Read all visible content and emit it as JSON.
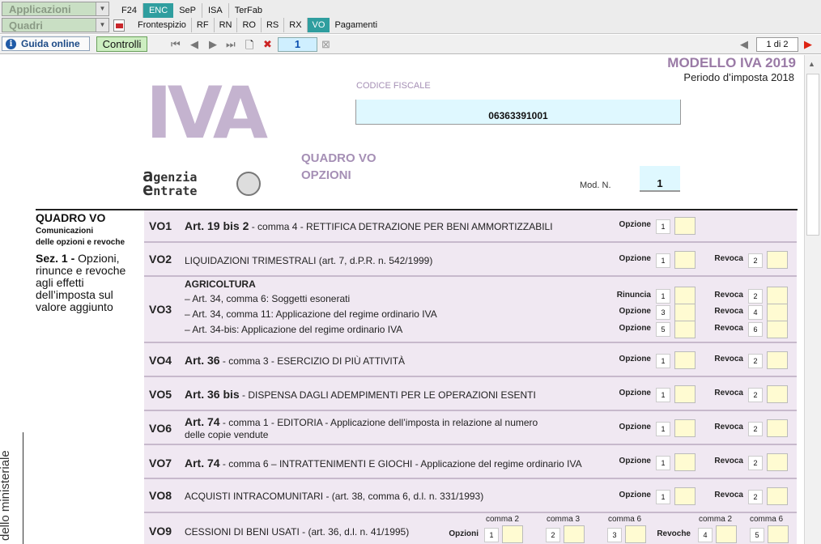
{
  "topbar": {
    "applicazioni": "Applicazioni",
    "quadri": "Quadri",
    "tabs1": [
      "F24",
      "ENC",
      "SeP",
      "ISA",
      "TerFab"
    ],
    "tabs2": [
      "Frontespizio",
      "RF",
      "RN",
      "RO",
      "RS",
      "RX",
      "VO",
      "Pagamenti"
    ]
  },
  "toolbar": {
    "guida": "Guida online",
    "controlli": "Controlli",
    "page": "1",
    "of": "1 di 2"
  },
  "header": {
    "title": "MODELLO IVA 2019",
    "period": "Periodo d’imposta 2018",
    "cf_label": "CODICE FISCALE",
    "cf_value": "06363391001",
    "quadro": "QUADRO VO",
    "opzioni": "OPZIONI",
    "mod_label": "Mod. N.",
    "mod_value": "1",
    "logo": "IVA",
    "agenzia1": "genzia",
    "agenzia2": "ntrate"
  },
  "left": {
    "q": "QUADRO VO",
    "c1": "Comunicazioni",
    "c2": "delle opzioni e revoche",
    "sez": "Sez. 1 -",
    "sez_text": "Opzioni, rinunce e revoche agli effetti dell’imposta sul valore aggiunto",
    "vertical": "dello ministeriale"
  },
  "rows": {
    "vo1": {
      "code": "VO1",
      "art": "Art. 19 bis 2",
      "text": "- comma 4 - RETTIFICA DETRAZIONE PER BENI AMMORTIZZABILI",
      "l1": "Opzione",
      "n1": "1"
    },
    "vo2": {
      "code": "VO2",
      "text": "LIQUIDAZIONI TRIMESTRALI  (art. 7, d.P.R. n. 542/1999)",
      "l1": "Opzione",
      "n1": "1",
      "l2": "Revoca",
      "n2": "2"
    },
    "vo3": {
      "code": "VO3",
      "head": "AGRICOLTURA",
      "t1": "– Art. 34, comma   6: Soggetti esonerati",
      "t2": "– Art. 34, comma 11: Applicazione del regime ordinario IVA",
      "t3": "– Art. 34-bis: Applicazione del regime ordinario IVA",
      "a": "Rinuncia",
      "b": "Opzione",
      "c": "Opzione",
      "r": "Revoca",
      "n1": "1",
      "n2": "2",
      "n3": "3",
      "n4": "4",
      "n5": "5",
      "n6": "6"
    },
    "vo4": {
      "code": "VO4",
      "art": "Art. 36",
      "text": "- comma 3 - ESERCIZIO DI PIÙ ATTIVITÀ",
      "l1": "Opzione",
      "n1": "1",
      "l2": "Revoca",
      "n2": "2"
    },
    "vo5": {
      "code": "VO5",
      "art": "Art. 36 bis",
      "text": "- DISPENSA DAGLI ADEMPIMENTI PER LE OPERAZIONI ESENTI",
      "l1": "Opzione",
      "n1": "1",
      "l2": "Revoca",
      "n2": "2"
    },
    "vo6": {
      "code": "VO6",
      "art": "Art. 74",
      "text": "- comma 1 - EDITORIA - Applicazione dell’imposta in relazione al numero",
      "text2": "delle copie vendute",
      "l1": "Opzione",
      "n1": "1",
      "l2": "Revoca",
      "n2": "2"
    },
    "vo7": {
      "code": "VO7",
      "art": "Art. 74",
      "text": "- comma   6 – INTRATTENIMENTI E GIOCHI - Applicazione del regime ordinario IVA",
      "l1": "Opzione",
      "n1": "1",
      "l2": "Revoca",
      "n2": "2"
    },
    "vo8": {
      "code": "VO8",
      "text": "ACQUISTI INTRACOMUNITARI - (art. 38, comma 6, d.l. n. 331/1993)",
      "l1": "Opzione",
      "n1": "1",
      "l2": "Revoca",
      "n2": "2"
    },
    "vo9": {
      "code": "VO9",
      "text": "CESSIONI DI BENI USATI - (art. 36, d.l. n. 41/1995)",
      "opz": "Opzioni",
      "rev": "Revoche",
      "c2": "comma 2",
      "c3": "comma 3",
      "c6": "comma 6",
      "n1": "1",
      "n2": "2",
      "n3": "3",
      "n4": "4",
      "n5": "5"
    }
  }
}
